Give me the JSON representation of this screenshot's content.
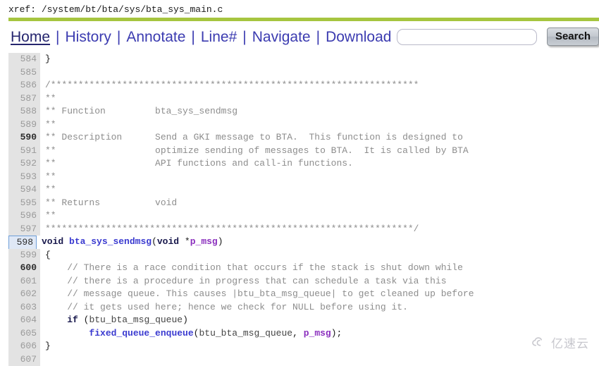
{
  "header": {
    "label": "xref:",
    "path": "/system/bt/bta/sys/bta_sys_main.c",
    "accent_color": "#a6c53f"
  },
  "menu": {
    "items": [
      {
        "label": "Home",
        "active": true
      },
      {
        "label": "History",
        "active": false
      },
      {
        "label": "Annotate",
        "active": false
      },
      {
        "label": "Line#",
        "active": false
      },
      {
        "label": "Navigate",
        "active": false
      },
      {
        "label": "Download",
        "active": false
      }
    ],
    "separator": "|",
    "search": {
      "value": "",
      "placeholder": "",
      "button_label": "Search"
    }
  },
  "code": {
    "current_line": 598,
    "lines": [
      {
        "n": "584",
        "text": "}"
      },
      {
        "n": "585",
        "text": ""
      },
      {
        "n": "586",
        "text": "/*******************************************************************"
      },
      {
        "n": "587",
        "text": "**"
      },
      {
        "n": "588",
        "text": "** Function         bta_sys_sendmsg"
      },
      {
        "n": "589",
        "text": "**"
      },
      {
        "n": "590",
        "text": "** Description      Send a GKI message to BTA.  This function is designed to"
      },
      {
        "n": "591",
        "text": "**                  optimize sending of messages to BTA.  It is called by BTA"
      },
      {
        "n": "592",
        "text": "**                  API functions and call-in functions."
      },
      {
        "n": "593",
        "text": "**"
      },
      {
        "n": "594",
        "text": "**"
      },
      {
        "n": "595",
        "text": "** Returns          void"
      },
      {
        "n": "596",
        "text": "**"
      },
      {
        "n": "597",
        "text": "*******************************************************************/"
      },
      {
        "n": "598",
        "text": "void bta_sys_sendmsg(void *p_msg)"
      },
      {
        "n": "599",
        "text": "{"
      },
      {
        "n": "600",
        "text": "    // There is a race condition that occurs if the stack is shut down while"
      },
      {
        "n": "601",
        "text": "    // there is a procedure in progress that can schedule a task via this"
      },
      {
        "n": "602",
        "text": "    // message queue. This causes |btu_bta_msg_queue| to get cleaned up before"
      },
      {
        "n": "603",
        "text": "    // it gets used here; hence we check for NULL before using it."
      },
      {
        "n": "604",
        "text": "    if (btu_bta_msg_queue)"
      },
      {
        "n": "605",
        "text": "        fixed_queue_enqueue(btu_bta_msg_queue, p_msg);"
      },
      {
        "n": "606",
        "text": "}"
      },
      {
        "n": "607",
        "text": ""
      }
    ]
  },
  "watermark": {
    "text": "亿速云",
    "icon": "cloud-icon"
  }
}
